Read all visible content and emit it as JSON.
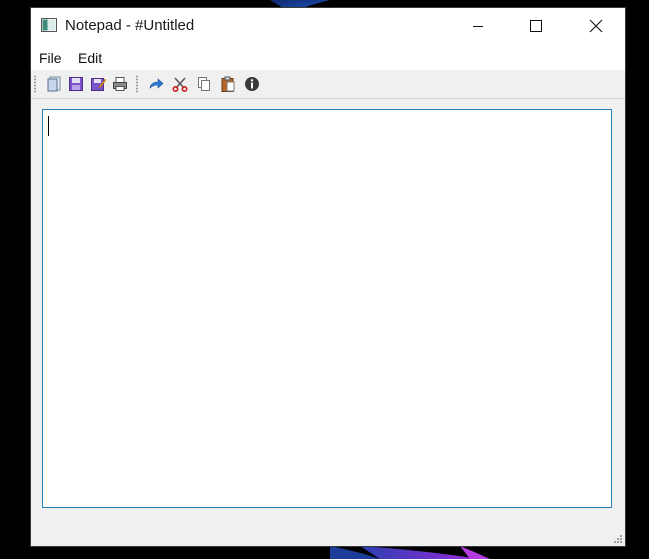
{
  "window": {
    "title": "Notepad - #Untitled",
    "icon": "notepad-app-icon",
    "controls": {
      "minimize_icon": "minimize-icon",
      "maximize_icon": "maximize-icon",
      "close_icon": "close-icon"
    }
  },
  "menubar": {
    "items": [
      {
        "label": "File"
      },
      {
        "label": "Edit"
      }
    ]
  },
  "toolbar": {
    "buttons": [
      {
        "name": "new-file",
        "icon": "new-document-icon"
      },
      {
        "name": "save",
        "icon": "save-icon"
      },
      {
        "name": "save-as",
        "icon": "save-as-icon"
      },
      {
        "name": "print",
        "icon": "printer-icon"
      },
      {
        "name": "redo",
        "icon": "redo-arrow-icon"
      },
      {
        "name": "cut",
        "icon": "scissors-icon"
      },
      {
        "name": "copy",
        "icon": "copy-icon"
      },
      {
        "name": "paste",
        "icon": "clipboard-icon"
      },
      {
        "name": "about",
        "icon": "info-icon"
      }
    ]
  },
  "editor": {
    "content": ""
  },
  "colors": {
    "editor_border": "#2b7fb8",
    "window_bg": "#f0f0f0",
    "titlebar_bg": "#ffffff"
  }
}
